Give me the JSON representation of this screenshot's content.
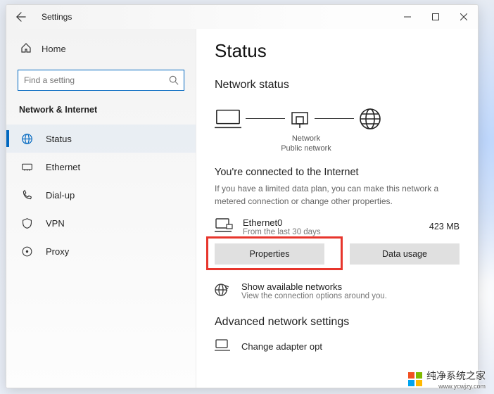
{
  "window": {
    "title": "Settings"
  },
  "sidebar": {
    "home": "Home",
    "search_placeholder": "Find a setting",
    "category": "Network & Internet",
    "items": [
      {
        "label": "Status",
        "icon": "status-icon",
        "active": true
      },
      {
        "label": "Ethernet",
        "icon": "ethernet-icon",
        "active": false
      },
      {
        "label": "Dial-up",
        "icon": "dialup-icon",
        "active": false
      },
      {
        "label": "VPN",
        "icon": "vpn-icon",
        "active": false
      },
      {
        "label": "Proxy",
        "icon": "proxy-icon",
        "active": false
      }
    ]
  },
  "main": {
    "page_title": "Status",
    "network_status_heading": "Network status",
    "diagram": {
      "network_label": "Network",
      "network_sub": "Public network"
    },
    "connected_heading": "You're connected to the Internet",
    "connected_sub": "If you have a limited data plan, you can make this network a metered connection or change other properties.",
    "connection": {
      "name": "Ethernet0",
      "sub": "From the last 30 days",
      "usage": "423 MB"
    },
    "buttons": {
      "properties": "Properties",
      "data_usage": "Data usage"
    },
    "available": {
      "title": "Show available networks",
      "sub": "View the connection options around you."
    },
    "advanced_heading": "Advanced network settings",
    "adapter_link": "Change adapter opt"
  },
  "watermark": {
    "text": "纯净系统之家",
    "url": "www.ycwjzy.com"
  }
}
